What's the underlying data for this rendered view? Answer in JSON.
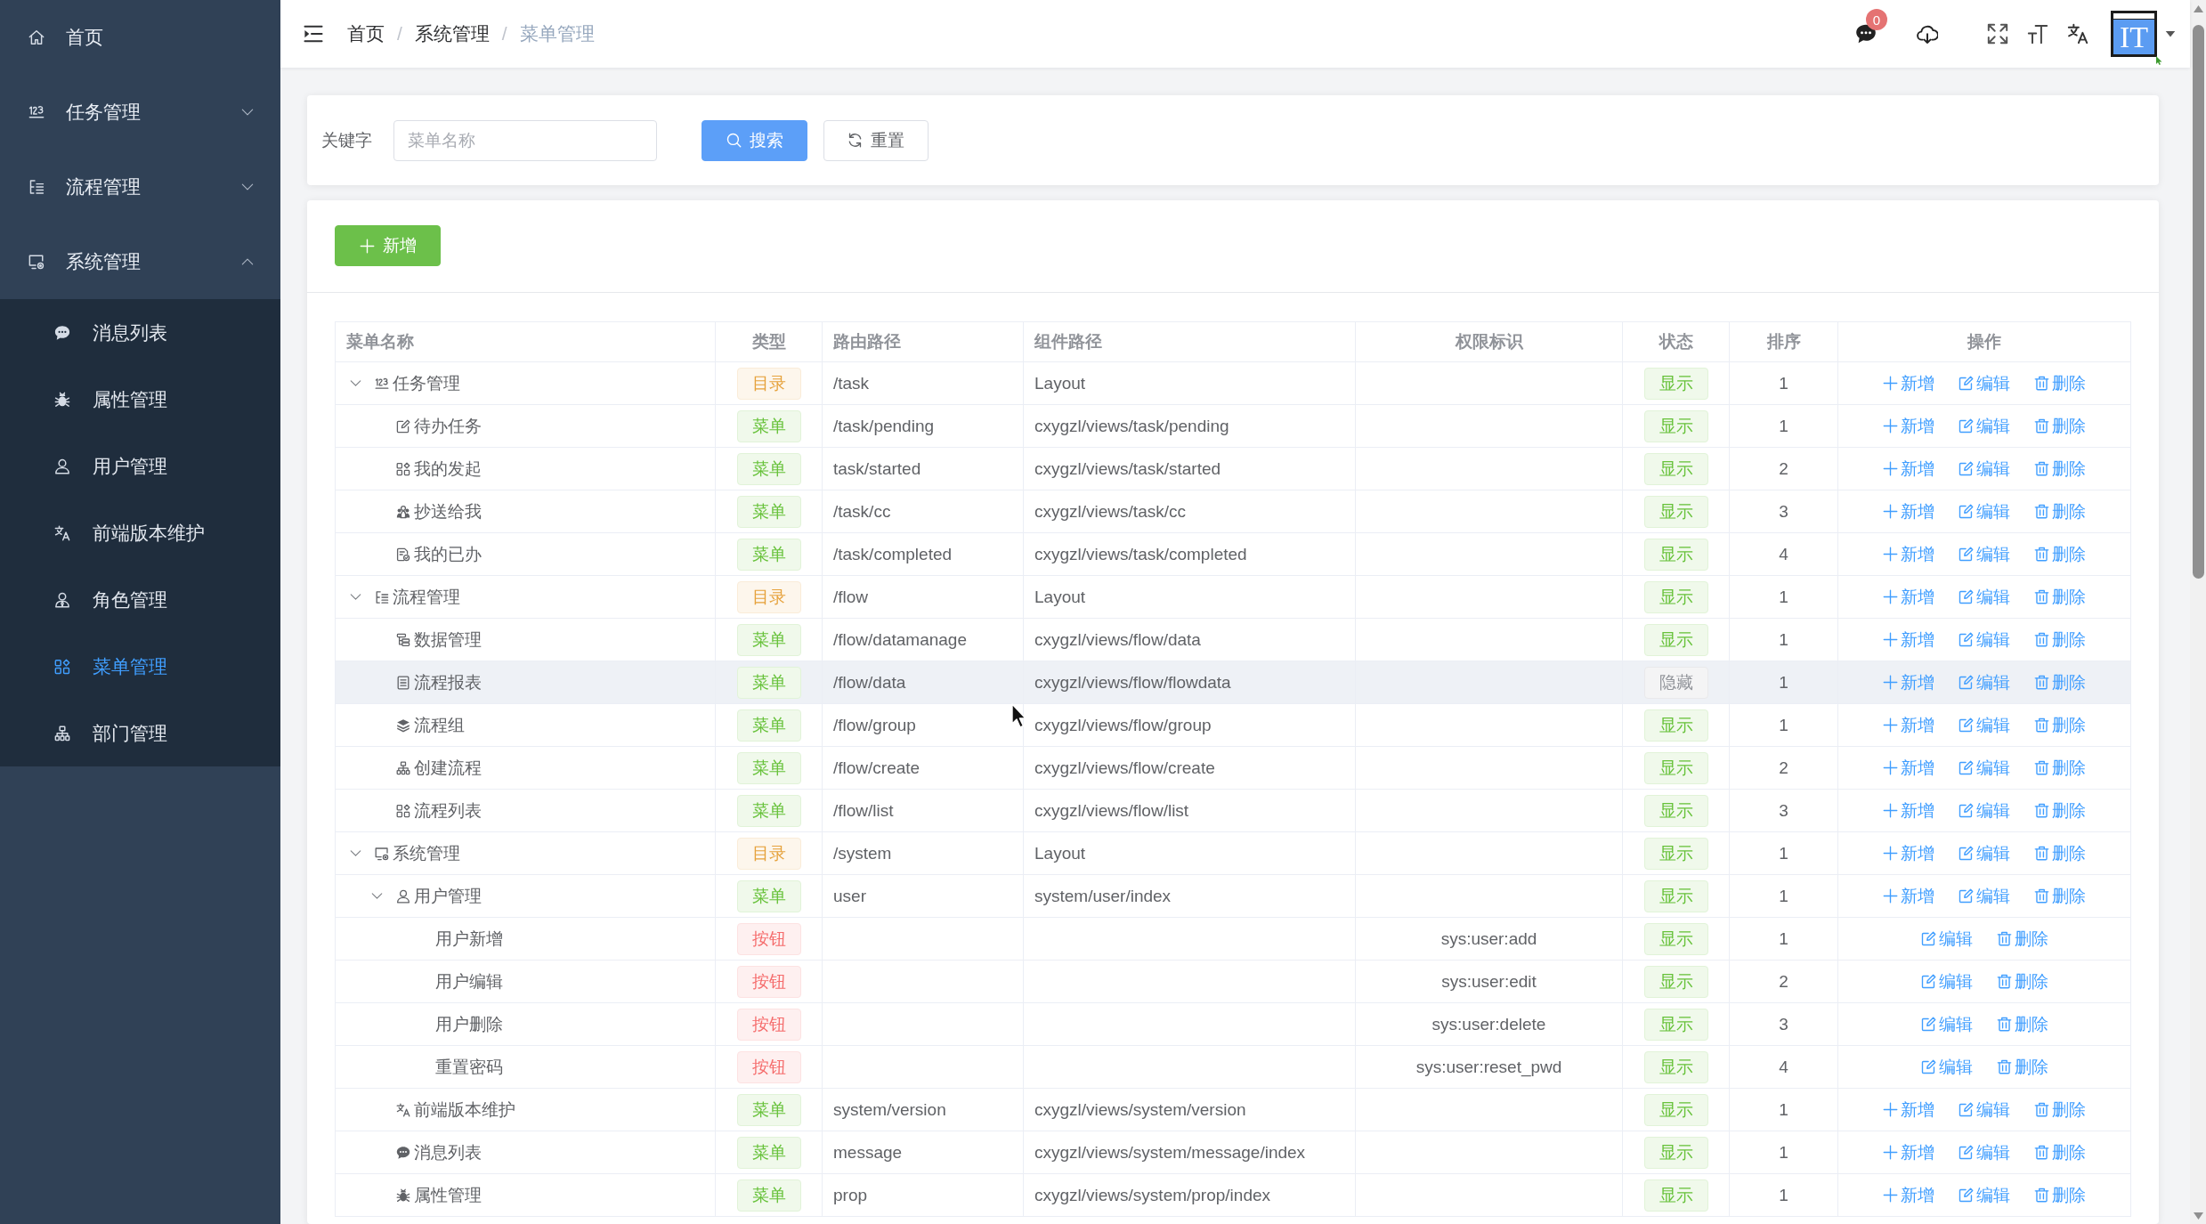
{
  "sidebar": {
    "items": [
      {
        "label": "首页",
        "selected": false
      },
      {
        "label": "任务管理",
        "expanded": false
      },
      {
        "label": "流程管理",
        "expanded": false
      },
      {
        "label": "系统管理",
        "expanded": true,
        "children": [
          {
            "label": "消息列表",
            "selected": false
          },
          {
            "label": "属性管理",
            "selected": false
          },
          {
            "label": "用户管理",
            "selected": false
          },
          {
            "label": "前端版本维护",
            "selected": false
          },
          {
            "label": "角色管理",
            "selected": false
          },
          {
            "label": "菜单管理",
            "selected": true
          },
          {
            "label": "部门管理",
            "selected": false
          }
        ]
      }
    ]
  },
  "header": {
    "breadcrumb": {
      "items": [
        {
          "label": "首页",
          "current": false
        },
        {
          "label": "系统管理",
          "current": false
        },
        {
          "label": "菜单管理",
          "current": true
        }
      ],
      "separators": [
        "/",
        "/"
      ]
    },
    "message_badge": "0",
    "avatar_text": "IT"
  },
  "search": {
    "label": "关键字",
    "placeholder": "菜单名称",
    "buttons": [
      {
        "kind": "search",
        "label": "搜索"
      },
      {
        "kind": "reset",
        "label": "重置"
      }
    ]
  },
  "toolbar": {
    "add_button": "新增"
  },
  "table": {
    "columns": [
      "菜单名称",
      "类型",
      "路由路径",
      "组件路径",
      "权限标识",
      "状态",
      "排序",
      "操作"
    ],
    "rows": [
      {
        "name": "任务管理",
        "type": {
          "kind": "directory",
          "label": "目录"
        },
        "route": "/task",
        "component": "Layout",
        "status": {
          "kind": "shown",
          "label": "显示"
        },
        "sort": "1",
        "hovered": false,
        "actions": [
          {
            "kind": "add",
            "label": "新增"
          },
          {
            "kind": "edit",
            "label": "编辑"
          },
          {
            "kind": "delete",
            "label": "删除"
          }
        ],
        "expanded": true,
        "children": [
          {
            "name": "待办任务",
            "type": {
              "kind": "menu",
              "label": "菜单"
            },
            "route": "/task/pending",
            "component": "cxygzl/views/task/pending",
            "status": {
              "kind": "shown",
              "label": "显示"
            },
            "sort": "1",
            "hovered": false,
            "actions": [
              {
                "kind": "add",
                "label": "新增"
              },
              {
                "kind": "edit",
                "label": "编辑"
              },
              {
                "kind": "delete",
                "label": "删除"
              }
            ]
          },
          {
            "name": "我的发起",
            "type": {
              "kind": "menu",
              "label": "菜单"
            },
            "route": "task/started",
            "component": "cxygzl/views/task/started",
            "status": {
              "kind": "shown",
              "label": "显示"
            },
            "sort": "2",
            "hovered": false,
            "actions": [
              {
                "kind": "add",
                "label": "新增"
              },
              {
                "kind": "edit",
                "label": "编辑"
              },
              {
                "kind": "delete",
                "label": "删除"
              }
            ]
          },
          {
            "name": "抄送给我",
            "type": {
              "kind": "menu",
              "label": "菜单"
            },
            "route": "/task/cc",
            "component": "cxygzl/views/task/cc",
            "status": {
              "kind": "shown",
              "label": "显示"
            },
            "sort": "3",
            "hovered": false,
            "actions": [
              {
                "kind": "add",
                "label": "新增"
              },
              {
                "kind": "edit",
                "label": "编辑"
              },
              {
                "kind": "delete",
                "label": "删除"
              }
            ]
          },
          {
            "name": "我的已办",
            "type": {
              "kind": "menu",
              "label": "菜单"
            },
            "route": "/task/completed",
            "component": "cxygzl/views/task/completed",
            "status": {
              "kind": "shown",
              "label": "显示"
            },
            "sort": "4",
            "hovered": false,
            "actions": [
              {
                "kind": "add",
                "label": "新增"
              },
              {
                "kind": "edit",
                "label": "编辑"
              },
              {
                "kind": "delete",
                "label": "删除"
              }
            ]
          }
        ]
      },
      {
        "name": "流程管理",
        "type": {
          "kind": "directory",
          "label": "目录"
        },
        "route": "/flow",
        "component": "Layout",
        "status": {
          "kind": "shown",
          "label": "显示"
        },
        "sort": "1",
        "hovered": false,
        "actions": [
          {
            "kind": "add",
            "label": "新增"
          },
          {
            "kind": "edit",
            "label": "编辑"
          },
          {
            "kind": "delete",
            "label": "删除"
          }
        ],
        "expanded": true,
        "children": [
          {
            "name": "数据管理",
            "type": {
              "kind": "menu",
              "label": "菜单"
            },
            "route": "/flow/datamanage",
            "component": "cxygzl/views/flow/data",
            "status": {
              "kind": "shown",
              "label": "显示"
            },
            "sort": "1",
            "hovered": false,
            "actions": [
              {
                "kind": "add",
                "label": "新增"
              },
              {
                "kind": "edit",
                "label": "编辑"
              },
              {
                "kind": "delete",
                "label": "删除"
              }
            ]
          },
          {
            "name": "流程报表",
            "type": {
              "kind": "menu",
              "label": "菜单"
            },
            "route": "/flow/data",
            "component": "cxygzl/views/flow/flowdata",
            "status": {
              "kind": "hidden",
              "label": "隐藏"
            },
            "sort": "1",
            "hovered": true,
            "actions": [
              {
                "kind": "add",
                "label": "新增"
              },
              {
                "kind": "edit",
                "label": "编辑"
              },
              {
                "kind": "delete",
                "label": "删除"
              }
            ]
          },
          {
            "name": "流程组",
            "type": {
              "kind": "menu",
              "label": "菜单"
            },
            "route": "/flow/group",
            "component": "cxygzl/views/flow/group",
            "status": {
              "kind": "shown",
              "label": "显示"
            },
            "sort": "1",
            "hovered": false,
            "actions": [
              {
                "kind": "add",
                "label": "新增"
              },
              {
                "kind": "edit",
                "label": "编辑"
              },
              {
                "kind": "delete",
                "label": "删除"
              }
            ]
          },
          {
            "name": "创建流程",
            "type": {
              "kind": "menu",
              "label": "菜单"
            },
            "route": "/flow/create",
            "component": "cxygzl/views/flow/create",
            "status": {
              "kind": "shown",
              "label": "显示"
            },
            "sort": "2",
            "hovered": false,
            "actions": [
              {
                "kind": "add",
                "label": "新增"
              },
              {
                "kind": "edit",
                "label": "编辑"
              },
              {
                "kind": "delete",
                "label": "删除"
              }
            ]
          },
          {
            "name": "流程列表",
            "type": {
              "kind": "menu",
              "label": "菜单"
            },
            "route": "/flow/list",
            "component": "cxygzl/views/flow/list",
            "status": {
              "kind": "shown",
              "label": "显示"
            },
            "sort": "3",
            "hovered": false,
            "actions": [
              {
                "kind": "add",
                "label": "新增"
              },
              {
                "kind": "edit",
                "label": "编辑"
              },
              {
                "kind": "delete",
                "label": "删除"
              }
            ]
          }
        ]
      },
      {
        "name": "系统管理",
        "type": {
          "kind": "directory",
          "label": "目录"
        },
        "route": "/system",
        "component": "Layout",
        "status": {
          "kind": "shown",
          "label": "显示"
        },
        "sort": "1",
        "hovered": false,
        "actions": [
          {
            "kind": "add",
            "label": "新增"
          },
          {
            "kind": "edit",
            "label": "编辑"
          },
          {
            "kind": "delete",
            "label": "删除"
          }
        ],
        "expanded": true,
        "children": [
          {
            "name": "用户管理",
            "type": {
              "kind": "menu",
              "label": "菜单"
            },
            "route": "user",
            "component": "system/user/index",
            "status": {
              "kind": "shown",
              "label": "显示"
            },
            "sort": "1",
            "hovered": false,
            "actions": [
              {
                "kind": "add",
                "label": "新增"
              },
              {
                "kind": "edit",
                "label": "编辑"
              },
              {
                "kind": "delete",
                "label": "删除"
              }
            ],
            "expanded": true,
            "children": [
              {
                "name": "用户新增",
                "type": {
                  "kind": "button",
                  "label": "按钮"
                },
                "permission": "sys:user:add",
                "status": {
                  "kind": "shown",
                  "label": "显示"
                },
                "sort": "1",
                "hovered": false,
                "actions": [
                  {
                    "kind": "edit",
                    "label": "编辑"
                  },
                  {
                    "kind": "delete",
                    "label": "删除"
                  }
                ]
              },
              {
                "name": "用户编辑",
                "type": {
                  "kind": "button",
                  "label": "按钮"
                },
                "permission": "sys:user:edit",
                "status": {
                  "kind": "shown",
                  "label": "显示"
                },
                "sort": "2",
                "hovered": false,
                "actions": [
                  {
                    "kind": "edit",
                    "label": "编辑"
                  },
                  {
                    "kind": "delete",
                    "label": "删除"
                  }
                ]
              },
              {
                "name": "用户删除",
                "type": {
                  "kind": "button",
                  "label": "按钮"
                },
                "permission": "sys:user:delete",
                "status": {
                  "kind": "shown",
                  "label": "显示"
                },
                "sort": "3",
                "hovered": false,
                "actions": [
                  {
                    "kind": "edit",
                    "label": "编辑"
                  },
                  {
                    "kind": "delete",
                    "label": "删除"
                  }
                ]
              },
              {
                "name": "重置密码",
                "type": {
                  "kind": "button",
                  "label": "按钮"
                },
                "permission": "sys:user:reset_pwd",
                "status": {
                  "kind": "shown",
                  "label": "显示"
                },
                "sort": "4",
                "hovered": false,
                "actions": [
                  {
                    "kind": "edit",
                    "label": "编辑"
                  },
                  {
                    "kind": "delete",
                    "label": "删除"
                  }
                ]
              }
            ]
          },
          {
            "name": "前端版本维护",
            "type": {
              "kind": "menu",
              "label": "菜单"
            },
            "route": "system/version",
            "component": "cxygzl/views/system/version",
            "status": {
              "kind": "shown",
              "label": "显示"
            },
            "sort": "1",
            "hovered": false,
            "actions": [
              {
                "kind": "add",
                "label": "新增"
              },
              {
                "kind": "edit",
                "label": "编辑"
              },
              {
                "kind": "delete",
                "label": "删除"
              }
            ]
          },
          {
            "name": "消息列表",
            "type": {
              "kind": "menu",
              "label": "菜单"
            },
            "route": "message",
            "component": "cxygzl/views/system/message/index",
            "status": {
              "kind": "shown",
              "label": "显示"
            },
            "sort": "1",
            "hovered": false,
            "actions": [
              {
                "kind": "add",
                "label": "新增"
              },
              {
                "kind": "edit",
                "label": "编辑"
              },
              {
                "kind": "delete",
                "label": "删除"
              }
            ]
          },
          {
            "name": "属性管理",
            "type": {
              "kind": "menu",
              "label": "菜单"
            },
            "route": "prop",
            "component": "cxygzl/views/system/prop/index",
            "status": {
              "kind": "shown",
              "label": "显示"
            },
            "sort": "1",
            "hovered": false,
            "actions": [
              {
                "kind": "add",
                "label": "新增"
              },
              {
                "kind": "edit",
                "label": "编辑"
              },
              {
                "kind": "delete",
                "label": "删除"
              }
            ]
          }
        ]
      }
    ]
  }
}
